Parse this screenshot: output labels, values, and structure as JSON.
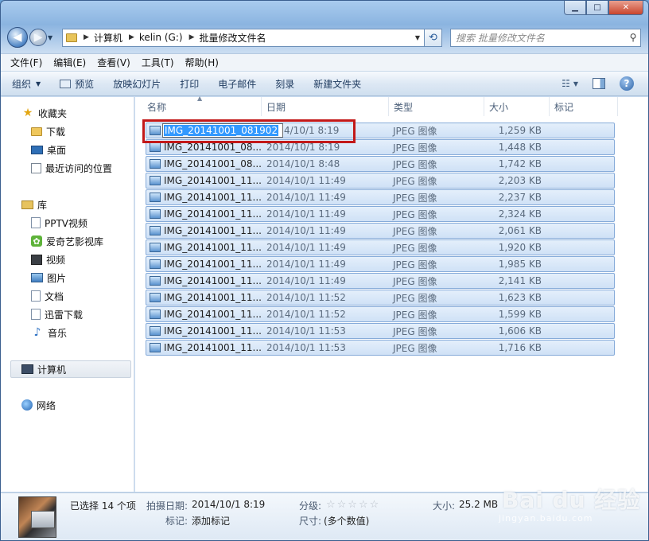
{
  "window": {
    "caption_buttons": {
      "minimize": "▁",
      "maximize": "□",
      "close": "✕"
    }
  },
  "address": {
    "crumbs": [
      "计算机",
      "kelin (G:)",
      "批量修改文件名"
    ],
    "search_placeholder": "搜索 批量修改文件名"
  },
  "menu": [
    "文件(F)",
    "编辑(E)",
    "查看(V)",
    "工具(T)",
    "帮助(H)"
  ],
  "toolbar": {
    "organize": "组织",
    "preview": "预览",
    "slideshow": "放映幻灯片",
    "print": "打印",
    "email": "电子邮件",
    "burn": "刻录",
    "new_folder": "新建文件夹",
    "help": "?"
  },
  "nav": {
    "favorites": "收藏夹",
    "downloads": "下载",
    "desktop": "桌面",
    "recent": "最近访问的位置",
    "libraries": "库",
    "pptv": "PPTV视频",
    "iqiyi": "爱奇艺影视库",
    "videos": "视频",
    "pictures": "图片",
    "documents": "文档",
    "thunder": "迅雷下载",
    "music": "音乐",
    "computer": "计算机",
    "network": "网络"
  },
  "columns": {
    "name": "名称",
    "date": "日期",
    "type": "类型",
    "size": "大小",
    "tags": "标记"
  },
  "rename_text": "IMG_20141001_081902",
  "files": [
    {
      "name": "",
      "date": "4/10/1 8:19",
      "type": "JPEG 图像",
      "size": "1,259 KB"
    },
    {
      "name": "IMG_20141001_08...",
      "date": "2014/10/1 8:19",
      "type": "JPEG 图像",
      "size": "1,448 KB"
    },
    {
      "name": "IMG_20141001_08...",
      "date": "2014/10/1 8:48",
      "type": "JPEG 图像",
      "size": "1,742 KB"
    },
    {
      "name": "IMG_20141001_11...",
      "date": "2014/10/1 11:49",
      "type": "JPEG 图像",
      "size": "2,203 KB"
    },
    {
      "name": "IMG_20141001_11...",
      "date": "2014/10/1 11:49",
      "type": "JPEG 图像",
      "size": "2,237 KB"
    },
    {
      "name": "IMG_20141001_11...",
      "date": "2014/10/1 11:49",
      "type": "JPEG 图像",
      "size": "2,324 KB"
    },
    {
      "name": "IMG_20141001_11...",
      "date": "2014/10/1 11:49",
      "type": "JPEG 图像",
      "size": "2,061 KB"
    },
    {
      "name": "IMG_20141001_11...",
      "date": "2014/10/1 11:49",
      "type": "JPEG 图像",
      "size": "1,920 KB"
    },
    {
      "name": "IMG_20141001_11...",
      "date": "2014/10/1 11:49",
      "type": "JPEG 图像",
      "size": "1,985 KB"
    },
    {
      "name": "IMG_20141001_11...",
      "date": "2014/10/1 11:49",
      "type": "JPEG 图像",
      "size": "2,141 KB"
    },
    {
      "name": "IMG_20141001_11...",
      "date": "2014/10/1 11:52",
      "type": "JPEG 图像",
      "size": "1,623 KB"
    },
    {
      "name": "IMG_20141001_11...",
      "date": "2014/10/1 11:52",
      "type": "JPEG 图像",
      "size": "1,599 KB"
    },
    {
      "name": "IMG_20141001_11...",
      "date": "2014/10/1 11:53",
      "type": "JPEG 图像",
      "size": "1,606 KB"
    },
    {
      "name": "IMG_20141001_11...",
      "date": "2014/10/1 11:53",
      "type": "JPEG 图像",
      "size": "1,716 KB"
    }
  ],
  "details": {
    "selected": "已选择 14 个项",
    "date_taken_label": "拍摄日期:",
    "date_taken": "2014/10/1 8:19",
    "tags_label": "标记:",
    "tags_value": "添加标记",
    "rating_label": "分级:",
    "stars": "☆☆☆☆☆",
    "size_label": "大小:",
    "size_value": "25.2 MB",
    "dims_label": "尺寸:",
    "dims_value": "(多个数值)"
  },
  "watermark": {
    "logo": "Bai du 经验",
    "url": "jingyan.baidu.com"
  }
}
